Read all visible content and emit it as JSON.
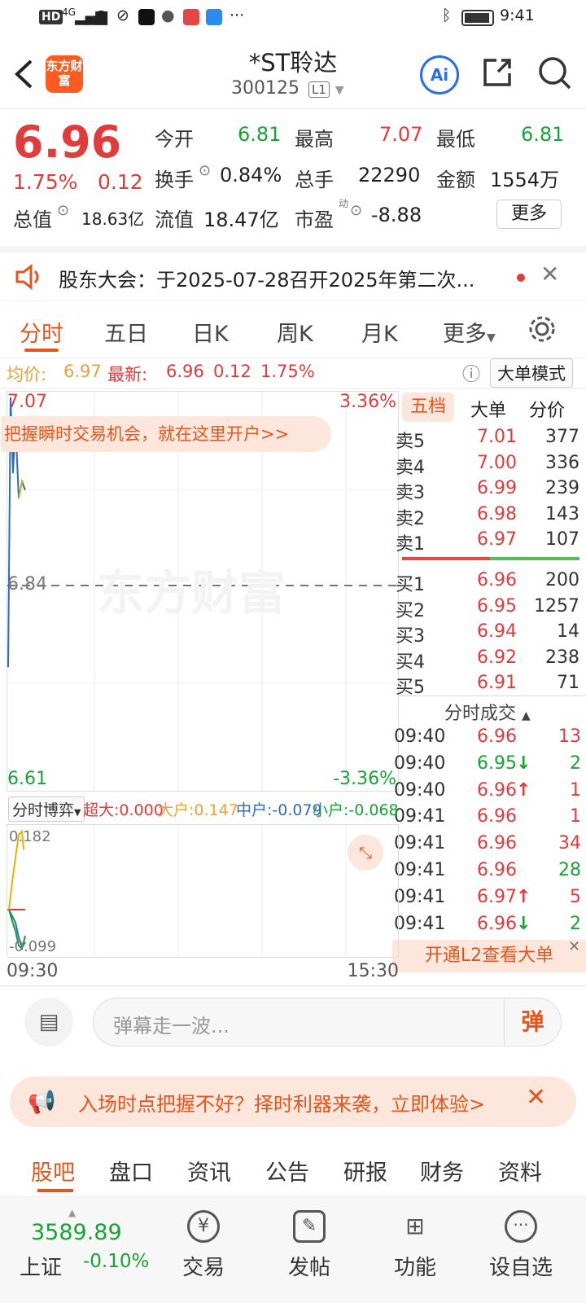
{
  "status": {
    "icons": [
      "HD",
      "4G"
    ],
    "time": "9:41"
  },
  "header": {
    "logo": "东方财富",
    "title": "*ST聆达",
    "code": "300125",
    "level": "L1",
    "ai": "Ai"
  },
  "quote": {
    "price": "6.96",
    "pct": "1.75%",
    "chg": "0.12",
    "open_label": "今开",
    "open": "6.81",
    "high_label": "最高",
    "high": "7.07",
    "low_label": "最低",
    "low": "6.81",
    "turnover_label": "换手",
    "turnover": "0.84%",
    "vol_label": "总手",
    "vol": "22290",
    "amt_label": "金额",
    "amt": "1554万",
    "mcap_label": "总值",
    "mcap": "18.63亿",
    "float_label": "流值",
    "float": "18.47亿",
    "pe_label": "市盈",
    "pe_sup": "动",
    "pe": "-8.88",
    "more": "更多"
  },
  "notice": {
    "text": "股东大会：于2025-07-28召开2025年第二次..."
  },
  "tabs": [
    "分时",
    "五日",
    "日K",
    "周K",
    "月K",
    "更多"
  ],
  "info": {
    "avg_label": "均价:",
    "avg": "6.97",
    "latest_label": "最新:",
    "latest": "6.96",
    "chg": "0.12",
    "pct": "1.75%",
    "mode": "大单模式"
  },
  "chart": {
    "top_price": "7.07",
    "top_pct": "3.36%",
    "mid_price": "6.84",
    "bot_price": "6.61",
    "bot_pct": "-3.36%",
    "banner": "把握瞬时交易机会，就在这里开户>>",
    "watermark": "东方财富",
    "price_series": [
      6.75,
      7.07,
      6.98,
      7.04,
      6.95,
      6.97,
      6.96
    ],
    "avg_series": [
      6.95,
      6.96,
      6.97,
      6.97
    ]
  },
  "book": {
    "tabs": [
      "五档",
      "大单",
      "分价"
    ],
    "asks": [
      {
        "l": "卖5",
        "p": "7.01",
        "v": "377"
      },
      {
        "l": "卖4",
        "p": "7.00",
        "v": "336"
      },
      {
        "l": "卖3",
        "p": "6.99",
        "v": "239"
      },
      {
        "l": "卖2",
        "p": "6.98",
        "v": "143"
      },
      {
        "l": "卖1",
        "p": "6.97",
        "v": "107"
      }
    ],
    "bids": [
      {
        "l": "买1",
        "p": "6.96",
        "v": "200"
      },
      {
        "l": "买2",
        "p": "6.95",
        "v": "1257"
      },
      {
        "l": "买3",
        "p": "6.94",
        "v": "14"
      },
      {
        "l": "买4",
        "p": "6.92",
        "v": "238"
      },
      {
        "l": "买5",
        "p": "6.91",
        "v": "71"
      }
    ]
  },
  "trades": {
    "title": "分时成交",
    "rows": [
      {
        "t": "09:40",
        "p": "6.96",
        "a": "",
        "v": "13",
        "vc": "red"
      },
      {
        "t": "09:40",
        "p": "6.95",
        "a": "↓",
        "v": "2",
        "vc": "green"
      },
      {
        "t": "09:40",
        "p": "6.96",
        "a": "↑",
        "v": "1",
        "vc": "red"
      },
      {
        "t": "09:41",
        "p": "6.96",
        "a": "",
        "v": "1",
        "vc": "red"
      },
      {
        "t": "09:41",
        "p": "6.96",
        "a": "",
        "v": "34",
        "vc": "red"
      },
      {
        "t": "09:41",
        "p": "6.96",
        "a": "",
        "v": "28",
        "vc": "green"
      },
      {
        "t": "09:41",
        "p": "6.97",
        "a": "↑",
        "v": "5",
        "vc": "red"
      },
      {
        "t": "09:41",
        "p": "6.96",
        "a": "↓",
        "v": "2",
        "vc": "green"
      }
    ],
    "l2": "开通L2查看大单"
  },
  "indicator": {
    "tab": "分时博弈",
    "super": "超大:0.000",
    "big": "大户:0.147",
    "mid": "中户:-0.079",
    "small": "小户:-0.068",
    "top": "0.182",
    "bot": "-0.099"
  },
  "time": {
    "start": "09:30",
    "end": "15:30"
  },
  "danmu": {
    "placeholder": "弹幕走一波...",
    "btn": "弹"
  },
  "promo": {
    "text": "入场时点把握不好？择时利器来袭，立即体验>"
  },
  "btabs": [
    "股吧",
    "盘口",
    "资讯",
    "公告",
    "研报",
    "财务",
    "资料"
  ],
  "bottom": {
    "index_val": "3589.89",
    "index_name": "上证",
    "index_pct": "-0.10%",
    "items": [
      "交易",
      "发帖",
      "功能",
      "设自选"
    ]
  }
}
